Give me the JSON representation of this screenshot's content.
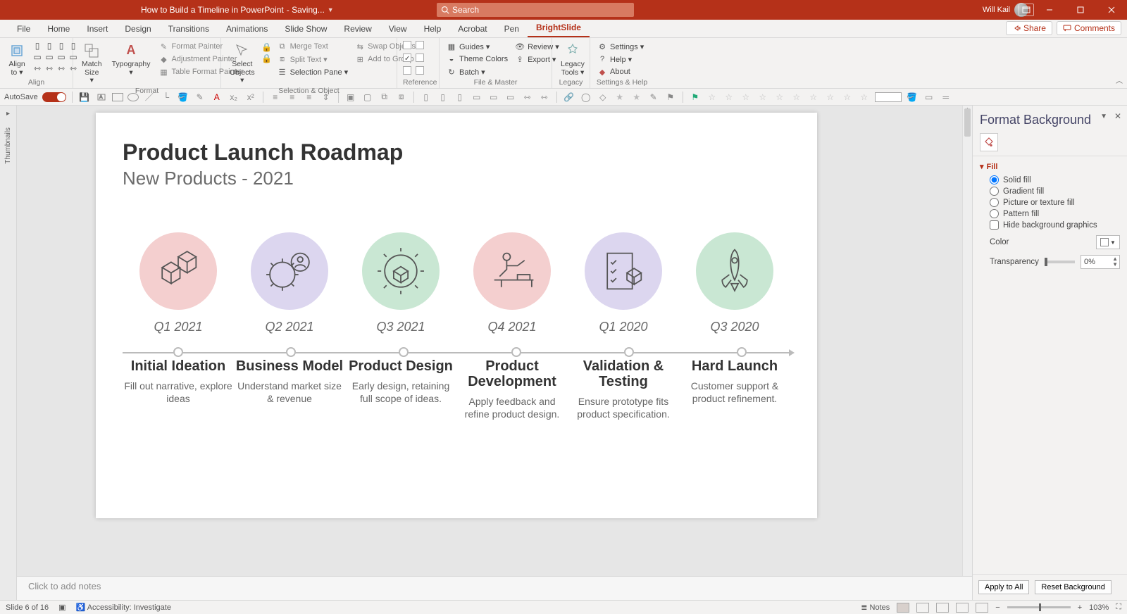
{
  "titlebar": {
    "doc_title": "How to Build a Timeline in PowerPoint",
    "save_state": " -  Saving...",
    "search_placeholder": "Search",
    "user_name": "Will Kail"
  },
  "tabs": {
    "items": [
      "File",
      "Home",
      "Insert",
      "Design",
      "Transitions",
      "Animations",
      "Slide Show",
      "Review",
      "View",
      "Help",
      "Acrobat",
      "Pen",
      "BrightSlide"
    ],
    "active": "BrightSlide",
    "share": "Share",
    "comments": "Comments"
  },
  "ribbon": {
    "align": {
      "label": "Align",
      "align_to": "Align to ▾"
    },
    "format": {
      "label": "Format",
      "match_size": "Match Size ▾",
      "typography": "Typography ▾",
      "format_painter": "Format Painter",
      "adjustment_painter": "Adjustment Painter",
      "table_format_painter": "Table Format Painter"
    },
    "selection": {
      "label": "Selection & Object",
      "select_objects": "Select Objects ▾",
      "merge_text": "Merge Text",
      "split_text": "Split Text ▾",
      "selection_pane": "Selection Pane ▾",
      "swap_objects": "Swap Objects",
      "add_to_group": "Add to Group"
    },
    "reference": {
      "label": "Reference"
    },
    "file_master": {
      "label": "File & Master",
      "guides": "Guides ▾",
      "theme_colors": "Theme Colors",
      "batch": "Batch ▾",
      "review": "Review ▾",
      "export": "Export ▾"
    },
    "legacy": {
      "label": "Legacy",
      "legacy_tools": "Legacy Tools ▾"
    },
    "settings": {
      "label": "Settings & Help",
      "settings": "Settings ▾",
      "help": "Help ▾",
      "about": "About"
    }
  },
  "qat": {
    "autosave": "AutoSave"
  },
  "thumbnails_label": "Thumbnails",
  "slide": {
    "title": "Product Launch Roadmap",
    "subtitle": "New Products - 2021",
    "items": [
      {
        "quarter": "Q1 2021",
        "title": "Initial Ideation",
        "desc": "Fill out narrative, explore ideas",
        "color": "c-pink"
      },
      {
        "quarter": "Q2 2021",
        "title": "Business Model",
        "desc": "Understand market size & revenue",
        "color": "c-purple"
      },
      {
        "quarter": "Q3 2021",
        "title": "Product Design",
        "desc": "Early design, retaining full scope of ideas.",
        "color": "c-green"
      },
      {
        "quarter": "Q4 2021",
        "title": "Product Development",
        "desc": "Apply feedback and refine product design.",
        "color": "c-pink"
      },
      {
        "quarter": "Q1 2020",
        "title": "Validation & Testing",
        "desc": "Ensure prototype fits product specification.",
        "color": "c-purple"
      },
      {
        "quarter": "Q3 2020",
        "title": "Hard Launch",
        "desc": "Customer support & product refinement.",
        "color": "c-green"
      }
    ]
  },
  "notes_placeholder": "Click to add notes",
  "pane": {
    "title": "Format Background",
    "section": "Fill",
    "solid": "Solid fill",
    "gradient": "Gradient fill",
    "picture": "Picture or texture fill",
    "pattern": "Pattern fill",
    "hide": "Hide background graphics",
    "color": "Color",
    "transparency": "Transparency",
    "transparency_val": "0%",
    "apply_all": "Apply to All",
    "reset": "Reset Background"
  },
  "status": {
    "slide": "Slide 6 of 16",
    "access": "Accessibility: Investigate",
    "notes": "Notes",
    "zoom": "103%"
  }
}
